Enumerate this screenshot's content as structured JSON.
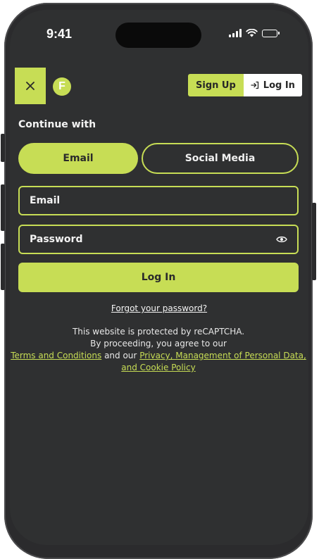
{
  "status_bar": {
    "time": "9:41"
  },
  "header": {
    "close_icon": "close-icon",
    "logo_letter": "F",
    "sign_up_label": "Sign Up",
    "log_in_label": "Log In",
    "log_in_icon": "login-arrow-icon"
  },
  "auth": {
    "continue_with": "Continue with",
    "tabs": [
      {
        "label": "Email",
        "selected": true
      },
      {
        "label": "Social Media",
        "selected": false
      }
    ],
    "email_placeholder": "Email",
    "password_placeholder": "Password",
    "password_toggle_icon": "eye-icon",
    "submit_label": "Log In",
    "forgot_password": "Forgot your password?"
  },
  "legal": {
    "line1": "This website is protected by reCAPTCHA.",
    "line2": "By proceeding, you agree to our",
    "terms_link": "Terms and Conditions",
    "connector": "and our",
    "privacy_link": "Privacy, Management of Personal Data, and Cookie Policy"
  },
  "colors": {
    "accent": "#c7dd55",
    "background": "#2f3031",
    "text": "#f2f2f2"
  }
}
